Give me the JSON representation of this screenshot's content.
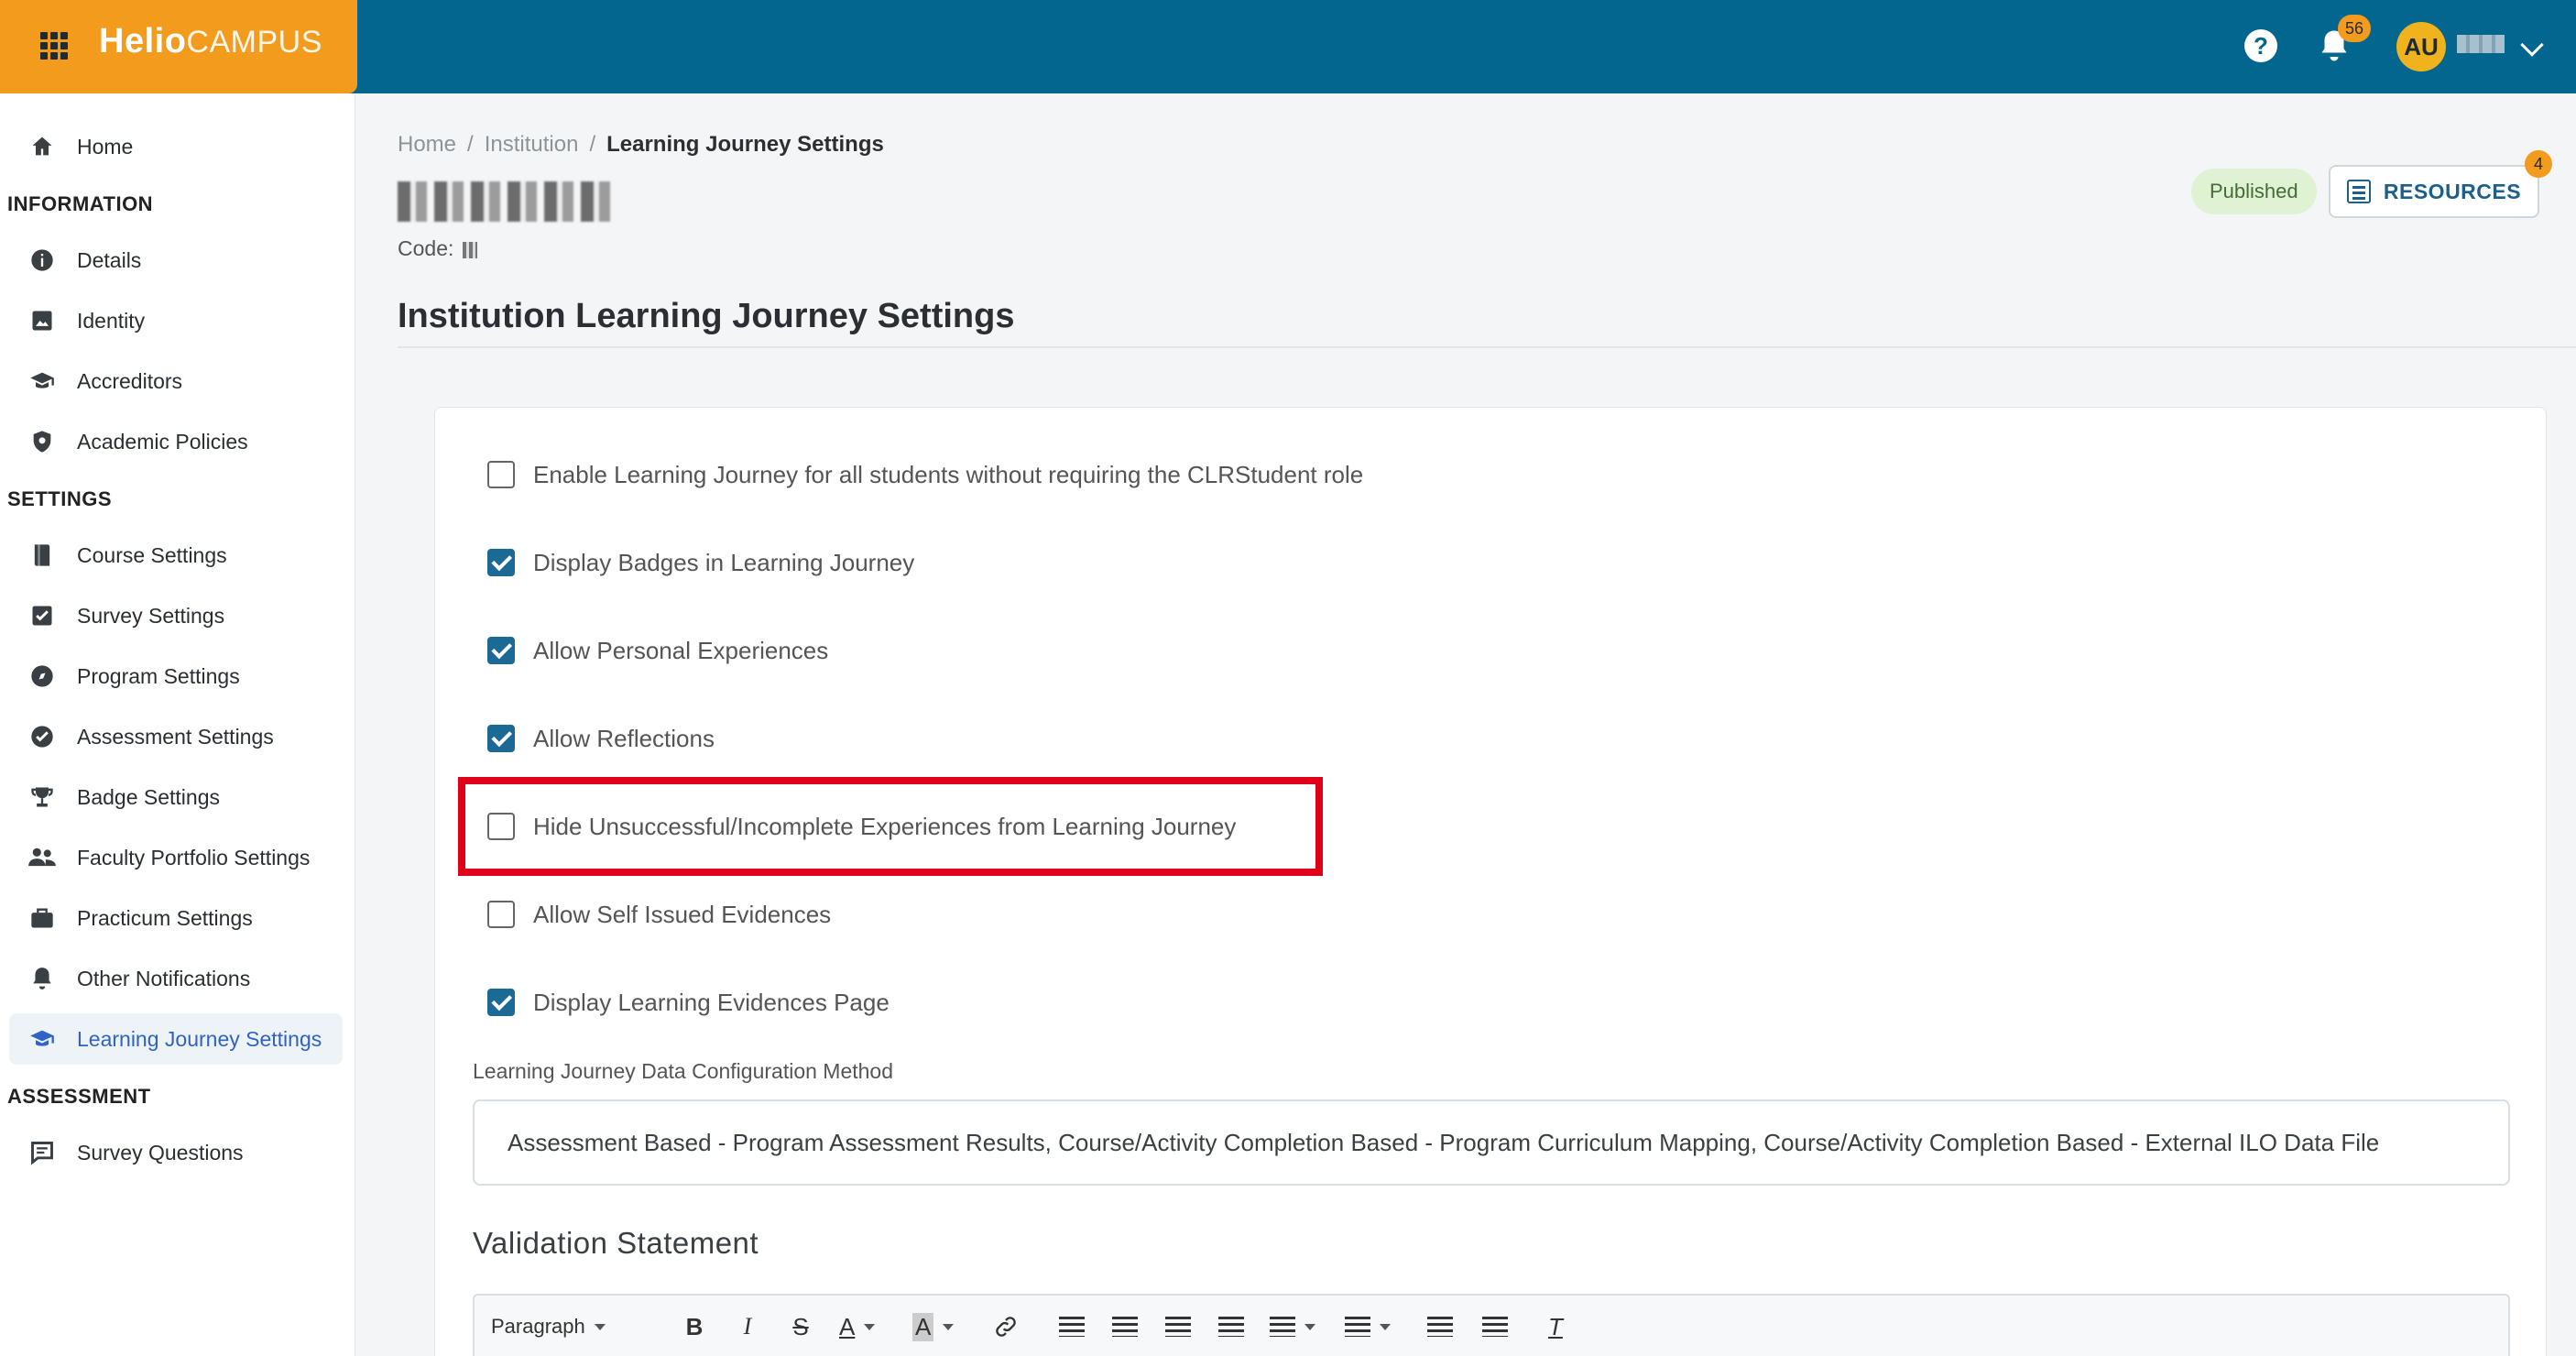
{
  "header": {
    "brand_part1": "Helio",
    "brand_part2": "CAMPUS",
    "help_glyph": "?",
    "notifications_count": "56",
    "avatar_initials": "AU"
  },
  "sidebar": {
    "items": [
      {
        "label": "Home",
        "icon": "home-icon"
      },
      {
        "label": "Details",
        "icon": "info-icon"
      },
      {
        "label": "Identity",
        "icon": "image-icon"
      },
      {
        "label": "Accreditors",
        "icon": "graduation-cap-icon"
      },
      {
        "label": "Academic Policies",
        "icon": "shield-gear-icon"
      },
      {
        "label": "Course Settings",
        "icon": "book-icon"
      },
      {
        "label": "Survey Settings",
        "icon": "checkbox-icon"
      },
      {
        "label": "Program Settings",
        "icon": "compass-icon"
      },
      {
        "label": "Assessment Settings",
        "icon": "check-circle-icon"
      },
      {
        "label": "Badge Settings",
        "icon": "trophy-icon"
      },
      {
        "label": "Faculty Portfolio Settings",
        "icon": "people-icon"
      },
      {
        "label": "Practicum Settings",
        "icon": "briefcase-icon"
      },
      {
        "label": "Other Notifications",
        "icon": "bell-icon"
      },
      {
        "label": "Learning Journey Settings",
        "icon": "graduation-cap-icon"
      },
      {
        "label": "Survey Questions",
        "icon": "comment-icon"
      }
    ],
    "sections": {
      "information": "INFORMATION",
      "settings": "SETTINGS",
      "assessment": "ASSESSMENT"
    },
    "active_item": "Learning Journey Settings"
  },
  "breadcrumb": {
    "home": "Home",
    "sep": "/",
    "institution": "Institution",
    "current": "Learning Journey Settings"
  },
  "entity": {
    "code_label": "Code:"
  },
  "status": {
    "published_label": "Published",
    "resources_label": "RESOURCES",
    "resources_count": "4"
  },
  "page_title": "Institution Learning Journey Settings",
  "settings": [
    {
      "label": "Enable Learning Journey for all students without requiring the CLRStudent role",
      "checked": false
    },
    {
      "label": "Display Badges in Learning Journey",
      "checked": true
    },
    {
      "label": "Allow Personal Experiences",
      "checked": true
    },
    {
      "label": "Allow Reflections",
      "checked": true
    },
    {
      "label": "Hide Unsuccessful/Incomplete Experiences from Learning Journey",
      "checked": false
    },
    {
      "label": "Allow Self Issued Evidences",
      "checked": false
    },
    {
      "label": "Display Learning Evidences Page",
      "checked": true
    }
  ],
  "config": {
    "label": "Learning Journey Data Configuration Method",
    "value": "Assessment Based - Program Assessment Results, Course/Activity Completion Based - Program Curriculum Mapping, Course/Activity Completion Based - External ILO Data File"
  },
  "validation": {
    "title": "Validation Statement",
    "toolbar": {
      "paragraph_label": "Paragraph",
      "bold_glyph": "B",
      "italic_glyph": "I",
      "strike_glyph": "S",
      "font_color_glyph": "A",
      "bg_color_glyph": "A",
      "clear_format_glyph": "T"
    }
  },
  "colors": {
    "topbar": "#03668f",
    "brand": "#f39b1c",
    "checkbox_checked": "#1a6a95",
    "highlight": "#e0001a"
  }
}
